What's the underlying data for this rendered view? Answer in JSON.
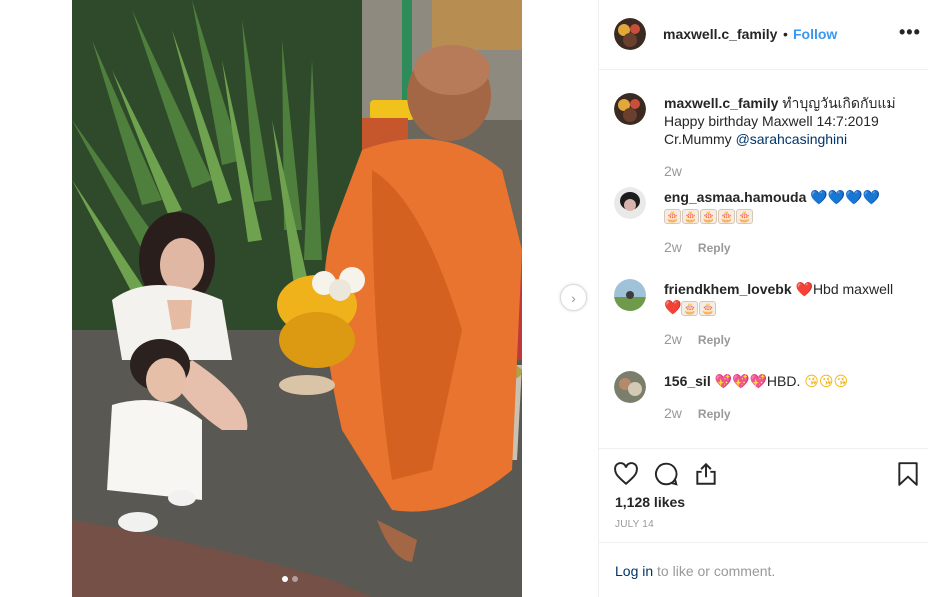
{
  "post": {
    "username": "maxwell.c_family",
    "follow_label": "Follow",
    "separator": "•",
    "more_label": "•••",
    "caption": {
      "line1": "ทำบุญวันเกิดกับแม่",
      "line2": "Happy birthday Maxwell 14:7:2019",
      "line3_prefix": "Cr.Mummy ",
      "mention": "@sarahcasinghini",
      "time": "2w"
    },
    "photo_dots": 2,
    "active_dot": 0,
    "next_icon": "chevron-right-icon"
  },
  "comments": [
    {
      "username": "eng_asmaa.hamouda",
      "hearts": "💙💙💙💙",
      "cakes": [
        "🎂",
        "🎂",
        "🎂",
        "🎂",
        "🎂"
      ],
      "time": "2w",
      "reply_label": "Reply"
    },
    {
      "username": "friendkhem_lovebk",
      "heart": "❤️",
      "text": "Hbd maxwell",
      "heart2": "❤️",
      "cakes": [
        "🎂",
        "🎂"
      ],
      "time": "2w",
      "reply_label": "Reply"
    },
    {
      "username": "156_sil",
      "hearts": "💖💖💖",
      "text": "HBD.",
      "kisses": "😘😘😘",
      "time": "2w",
      "reply_label": "Reply"
    }
  ],
  "actions": {
    "like_icon": "heart-outline-icon",
    "comment_icon": "comment-bubble-icon",
    "share_icon": "share-upload-icon",
    "save_icon": "bookmark-icon"
  },
  "likes_text": "1,128 likes",
  "date_text": "JULY 14",
  "login": {
    "link": "Log in",
    "rest": " to like or comment."
  },
  "colors": {
    "link_blue": "#3897f0",
    "mention_blue": "#003569",
    "muted": "#999999",
    "text": "#262626",
    "border": "#efefef"
  }
}
